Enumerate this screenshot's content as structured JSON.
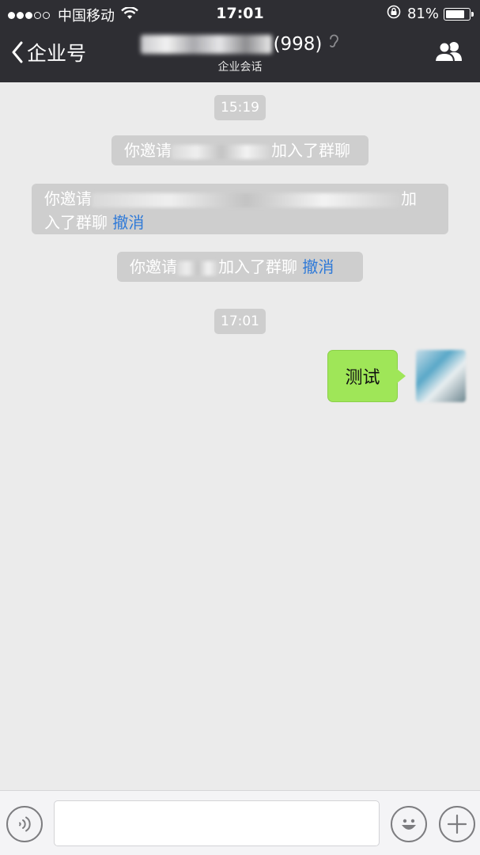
{
  "status_bar": {
    "carrier": "中国移动",
    "time": "17:01",
    "battery": "81%",
    "battery_level": 0.81,
    "signal_bars_filled": 3,
    "signal_bars_total": 5
  },
  "nav": {
    "back_label": "企业号",
    "member_count": "(998)",
    "subtitle": "企业会话"
  },
  "chat": {
    "time_1": "15:19",
    "time_2": "17:01",
    "system_messages": [
      {
        "prefix": "你邀请",
        "suffix": "加入了群聊"
      },
      {
        "prefix": "你邀请",
        "suffix": "加",
        "line2": "入了群聊",
        "action": "撤消"
      },
      {
        "prefix": "你邀请",
        "suffix": "加入了群聊",
        "action": "撤消"
      }
    ],
    "my_message": "测试"
  },
  "input_bar": {
    "placeholder": ""
  },
  "colors": {
    "topbar": "#2e2e33",
    "chat_bg": "#ebebeb",
    "bubble": "#9fe658",
    "revoke_link": "#2f7ad8"
  },
  "icons": {
    "back": "chevron-left-icon",
    "ear": "ear-icon",
    "group": "group-members-icon",
    "voice": "voice-icon",
    "emoji": "emoji-icon",
    "plus": "plus-icon",
    "wifi": "wifi-icon",
    "lock": "rotation-lock-icon"
  }
}
